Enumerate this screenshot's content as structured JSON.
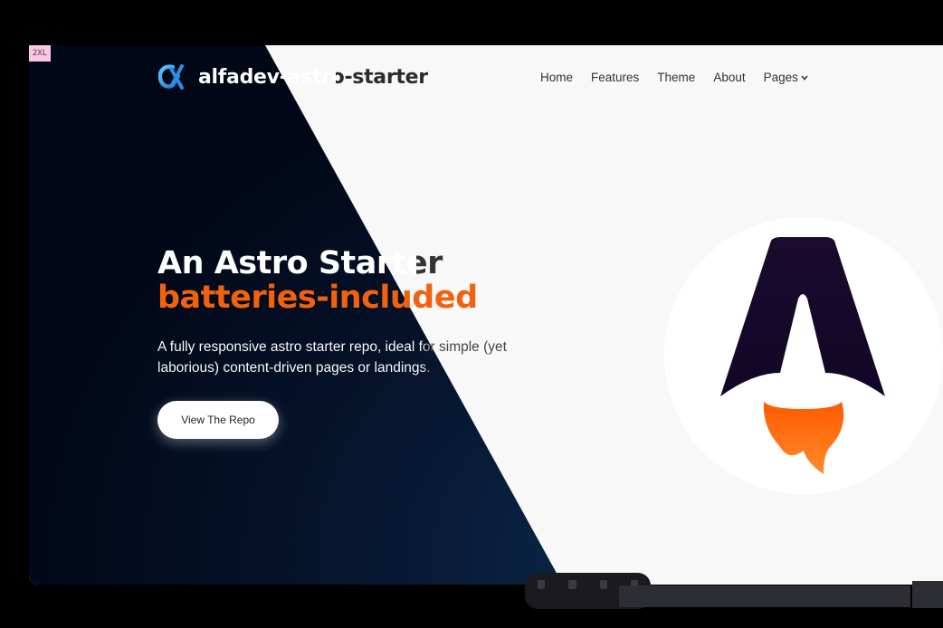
{
  "breakpoint_badge": "2XL",
  "header": {
    "logo_icon": "alfadev-alpha-logo-icon",
    "site_name": "alfadev-astro-starter",
    "nav": [
      {
        "label": "Home"
      },
      {
        "label": "Features"
      },
      {
        "label": "Theme"
      },
      {
        "label": "About"
      },
      {
        "label": "Pages",
        "icon": "chevron-down-icon"
      }
    ]
  },
  "hero": {
    "title_line1": "An Astro Starter",
    "title_line2": "batteries-included",
    "subtitle": "A fully responsive astro starter repo, ideal for simple (yet laborious) content-driven pages or landings.",
    "cta_label": "View The Repo",
    "illustration_icon": "astro-rocket-logo-icon"
  },
  "colors": {
    "accent": "#f2610f",
    "dark_background": "#020818",
    "light_background": "#f8f8f8",
    "astro_logo_dark": "#1a0b2e"
  }
}
